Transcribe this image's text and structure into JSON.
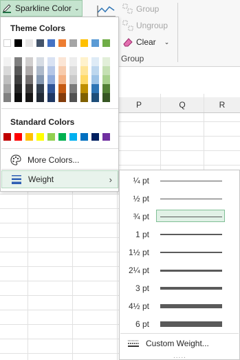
{
  "ribbon": {
    "sparkline_color_label": "Sparkline Color",
    "group_label": "Group",
    "ungroup_label": "Ungroup",
    "clear_label": "Clear",
    "group_section_label": "Group"
  },
  "sheet": {
    "columns": [
      "P",
      "Q",
      "R"
    ]
  },
  "color_menu": {
    "theme_heading": "Theme Colors",
    "standard_heading": "Standard Colors",
    "more_colors_label": "More Colors...",
    "weight_label": "Weight",
    "theme_colors": [
      "#ffffff",
      "#000000",
      "#e7e6e6",
      "#44546a",
      "#4472c4",
      "#ed7d31",
      "#a5a5a5",
      "#ffc000",
      "#5b9bd5",
      "#70ad47"
    ],
    "theme_shades": [
      [
        "#f2f2f2",
        "#d9d9d9",
        "#bfbfbf",
        "#a6a6a6",
        "#808080"
      ],
      [
        "#7f7f7f",
        "#595959",
        "#404040",
        "#262626",
        "#0d0d0d"
      ],
      [
        "#d0cece",
        "#aeaaaa",
        "#757171",
        "#3a3838",
        "#171616"
      ],
      [
        "#d6dce4",
        "#adb9ca",
        "#8497b0",
        "#333f4f",
        "#222a35"
      ],
      [
        "#d9e2f3",
        "#b4c6e7",
        "#8eaadb",
        "#2f5496",
        "#1f3864"
      ],
      [
        "#fbe5d5",
        "#f7cbac",
        "#f4b183",
        "#c55a11",
        "#833c0b"
      ],
      [
        "#ededed",
        "#dbdbdb",
        "#c9c9c9",
        "#7b7b7b",
        "#525252"
      ],
      [
        "#fff2cc",
        "#ffe599",
        "#ffd966",
        "#bf8f00",
        "#7f6000"
      ],
      [
        "#deebf6",
        "#bdd7ee",
        "#9dc3e6",
        "#2e75b5",
        "#1e4e79"
      ],
      [
        "#e2efd9",
        "#c5e0b3",
        "#a8d08d",
        "#538135",
        "#375623"
      ]
    ],
    "standard_colors": [
      "#c00000",
      "#ff0000",
      "#ffc000",
      "#ffff00",
      "#92d050",
      "#00b050",
      "#00b0f0",
      "#0070c0",
      "#002060",
      "#7030a0"
    ]
  },
  "weight_menu": {
    "items": [
      {
        "label": "¼ pt",
        "thickness": 1
      },
      {
        "label": "½ pt",
        "thickness": 1
      },
      {
        "label": "¾ pt",
        "thickness": 1
      },
      {
        "label": "1 pt",
        "thickness": 2
      },
      {
        "label": "1½ pt",
        "thickness": 2
      },
      {
        "label": "2¼ pt",
        "thickness": 3
      },
      {
        "label": "3 pt",
        "thickness": 4
      },
      {
        "label": "4½ pt",
        "thickness": 6
      },
      {
        "label": "6 pt",
        "thickness": 8
      }
    ],
    "selected_label": "¾ pt",
    "custom_label": "Custom Weight...",
    "grip": "....."
  }
}
